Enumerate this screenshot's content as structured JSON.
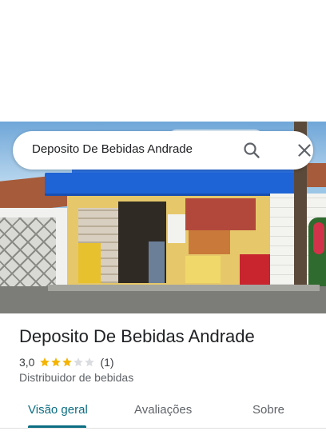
{
  "search": {
    "query": "Deposito De Bebidas Andrade",
    "search_icon": "search-icon",
    "close_icon": "close-icon"
  },
  "place": {
    "name": "Deposito De Bebidas Andrade",
    "rating": "3,0",
    "rating_value": 3,
    "rating_max": 5,
    "review_count": "(1)",
    "category": "Distribuidor de bebidas"
  },
  "tabs": [
    {
      "label": "Visão geral",
      "active": true
    },
    {
      "label": "Avaliações",
      "active": false
    },
    {
      "label": "Sobre",
      "active": false
    }
  ],
  "colors": {
    "accent": "#0b6e82",
    "star_filled": "#f4b400",
    "star_empty": "#dadce0"
  }
}
